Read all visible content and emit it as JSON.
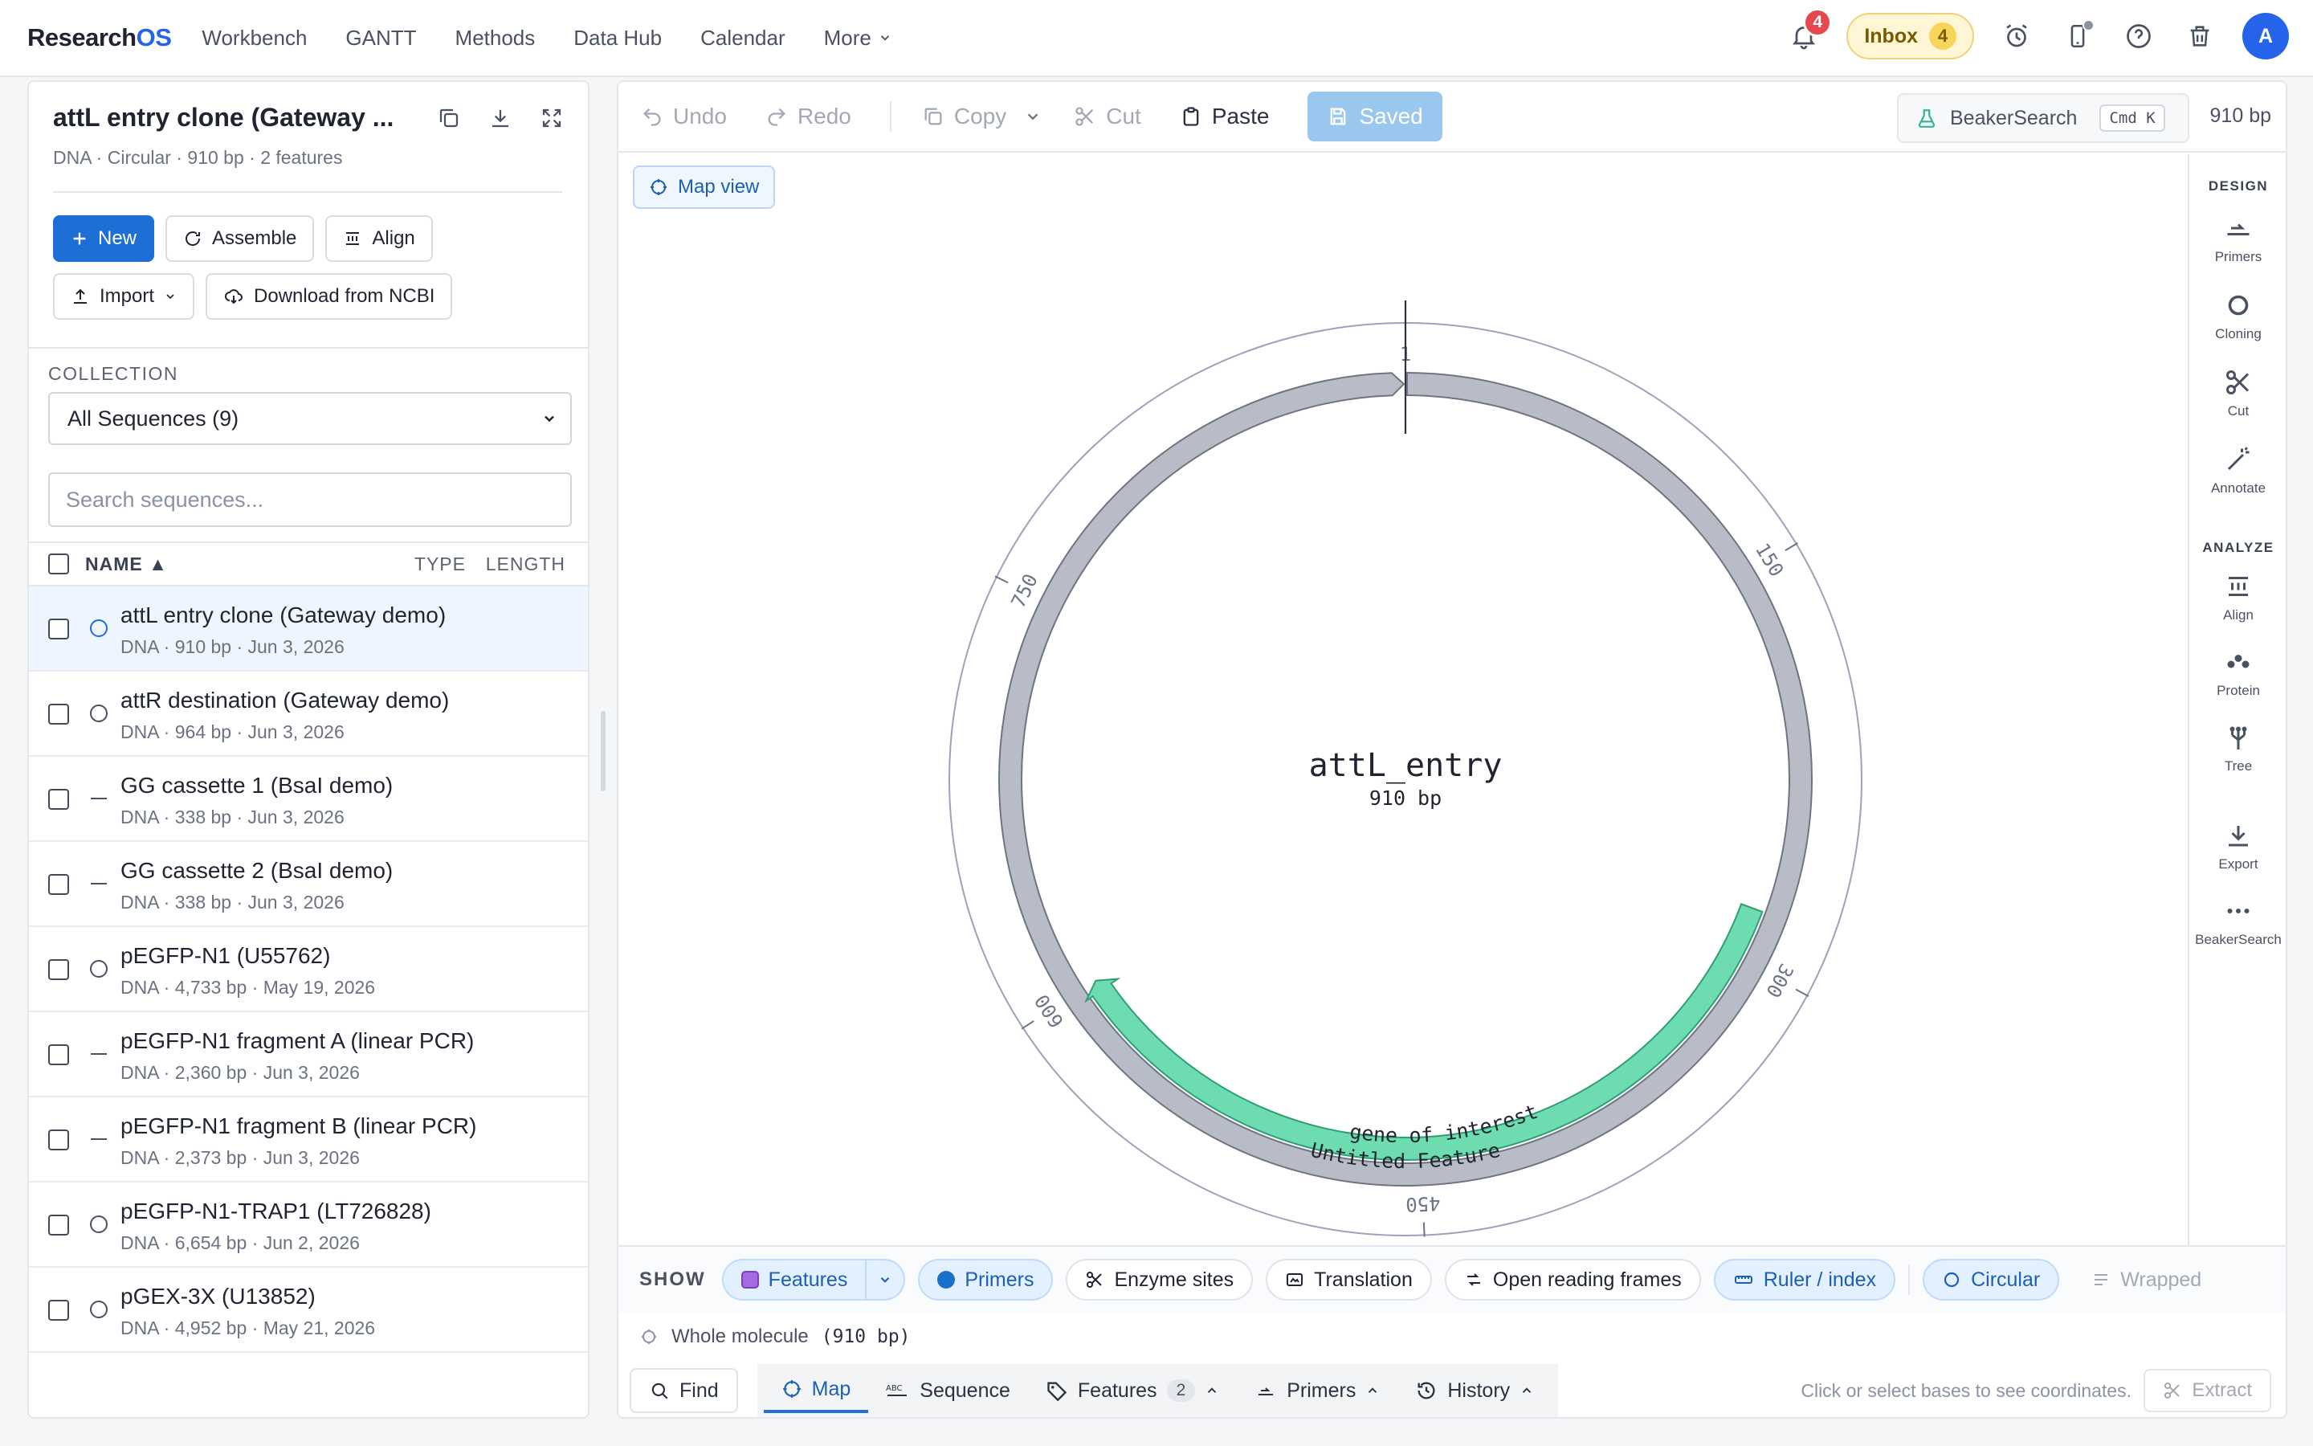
{
  "app": {
    "logo_main": "Research",
    "logo_accent": "OS"
  },
  "nav": [
    {
      "label": "Workbench"
    },
    {
      "label": "GANTT"
    },
    {
      "label": "Methods"
    },
    {
      "label": "Data Hub"
    },
    {
      "label": "Calendar"
    },
    {
      "label": "More"
    }
  ],
  "topbar": {
    "notifications_count": "4",
    "inbox_label": "Inbox",
    "inbox_count": "4",
    "avatar_initial": "A"
  },
  "sidebar": {
    "title": "attL entry clone (Gateway ...",
    "subtitle": "DNA · Circular · 910 bp · 2 features",
    "buttons": {
      "new": "New",
      "assemble": "Assemble",
      "align": "Align",
      "import": "Import",
      "download_ncbi": "Download from NCBI"
    },
    "collection_label": "COLLECTION",
    "collection_value": "All Sequences (9)",
    "search_placeholder": "Search sequences...",
    "columns": {
      "name": "NAME ▲",
      "type": "TYPE",
      "length": "LENGTH"
    },
    "sequences": [
      {
        "name": "attL entry clone (Gateway demo)",
        "meta": "DNA · 910 bp · Jun 3, 2026",
        "topology": "circular",
        "selected": true
      },
      {
        "name": "attR destination (Gateway demo)",
        "meta": "DNA · 964 bp · Jun 3, 2026",
        "topology": "circular",
        "selected": false
      },
      {
        "name": "GG cassette 1 (BsaI demo)",
        "meta": "DNA · 338 bp · Jun 3, 2026",
        "topology": "linear",
        "selected": false
      },
      {
        "name": "GG cassette 2 (BsaI demo)",
        "meta": "DNA · 338 bp · Jun 3, 2026",
        "topology": "linear",
        "selected": false
      },
      {
        "name": "pEGFP-N1 (U55762)",
        "meta": "DNA · 4,733 bp · May 19, 2026",
        "topology": "circular",
        "selected": false
      },
      {
        "name": "pEGFP-N1 fragment A (linear PCR)",
        "meta": "DNA · 2,360 bp · Jun 3, 2026",
        "topology": "linear",
        "selected": false
      },
      {
        "name": "pEGFP-N1 fragment B (linear PCR)",
        "meta": "DNA · 2,373 bp · Jun 3, 2026",
        "topology": "linear",
        "selected": false
      },
      {
        "name": "pEGFP-N1-TRAP1 (LT726828)",
        "meta": "DNA · 6,654 bp · Jun 2, 2026",
        "topology": "circular",
        "selected": false
      },
      {
        "name": "pGEX-3X (U13852)",
        "meta": "DNA · 4,952 bp · May 21, 2026",
        "topology": "circular",
        "selected": false
      }
    ]
  },
  "toolbar": {
    "undo": "Undo",
    "redo": "Redo",
    "copy": "Copy",
    "cut": "Cut",
    "paste": "Paste",
    "saved": "Saved",
    "beaker_label": "BeakerSearch",
    "beaker_shortcut": "Cmd K",
    "total_bp": "910 bp"
  },
  "map": {
    "view_button": "Map view",
    "name": "attL_entry",
    "length_label": "910 bp",
    "total_bp": 910,
    "ticks": [
      {
        "pos": 1,
        "label": "1"
      },
      {
        "pos": 150,
        "label": "150"
      },
      {
        "pos": 300,
        "label": "300"
      },
      {
        "pos": 450,
        "label": "450"
      },
      {
        "pos": 600,
        "label": "600"
      },
      {
        "pos": 750,
        "label": "750"
      }
    ],
    "features": [
      {
        "name": "Untitled Feature",
        "start": 1,
        "end": 910,
        "color": "#b8bcc6",
        "strand": "reverse"
      },
      {
        "name": "gene of interest",
        "start": 280,
        "end": 600,
        "color": "#6ddcb0",
        "strand": "reverse"
      }
    ]
  },
  "rail": {
    "design_label": "DESIGN",
    "analyze_label": "ANALYZE",
    "design": [
      {
        "label": "Primers",
        "icon": "primers-icon"
      },
      {
        "label": "Cloning",
        "icon": "cloning-icon"
      },
      {
        "label": "Cut",
        "icon": "scissors-icon"
      },
      {
        "label": "Annotate",
        "icon": "wand-icon"
      }
    ],
    "analyze": [
      {
        "label": "Align",
        "icon": "align-icon"
      },
      {
        "label": "Protein",
        "icon": "protein-icon"
      },
      {
        "label": "Tree",
        "icon": "tree-icon"
      },
      {
        "label": "Export",
        "icon": "export-icon"
      },
      {
        "label": "BeakerSearch",
        "icon": "more-icon"
      }
    ]
  },
  "show": {
    "label": "SHOW",
    "features": "Features",
    "primers": "Primers",
    "enzyme_sites": "Enzyme sites",
    "translation": "Translation",
    "orfs": "Open reading frames",
    "ruler": "Ruler / index",
    "circular": "Circular",
    "wrapped": "Wrapped"
  },
  "selection": {
    "label": "Whole molecule",
    "range": "(910 bp)"
  },
  "bottom": {
    "find": "Find",
    "tabs": {
      "map": "Map",
      "sequence": "Sequence",
      "features": "Features",
      "features_count": "2",
      "primers": "Primers",
      "history": "History"
    },
    "hint": "Click or select bases to see coordinates.",
    "extract": "Extract"
  }
}
